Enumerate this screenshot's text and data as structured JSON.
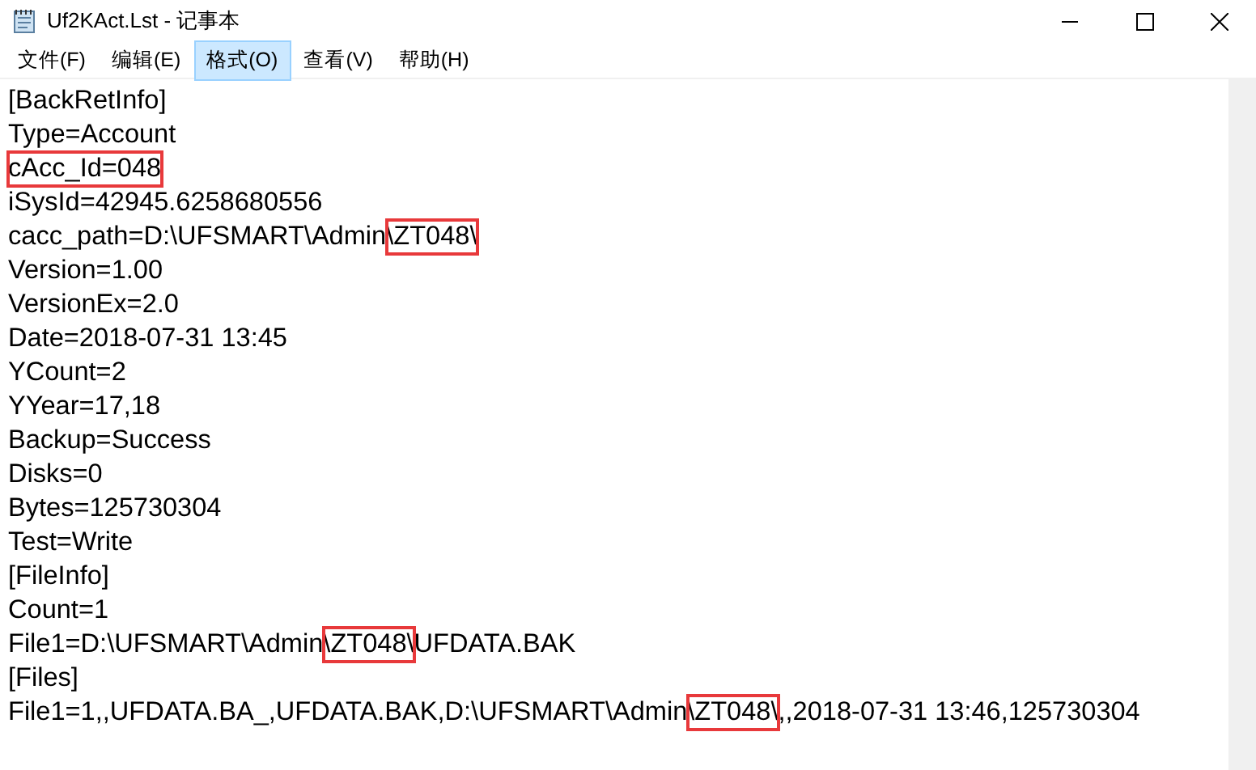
{
  "window": {
    "title": "Uf2KAct.Lst - 记事本"
  },
  "menu": [
    {
      "label": "文件(F)",
      "selected": false
    },
    {
      "label": "编辑(E)",
      "selected": false
    },
    {
      "label": "格式(O)",
      "selected": true
    },
    {
      "label": "查看(V)",
      "selected": false
    },
    {
      "label": "帮助(H)",
      "selected": false
    }
  ],
  "lines": [
    [
      {
        "text": "[BackRetInfo]",
        "boxed": false
      }
    ],
    [
      {
        "text": "Type=Account",
        "boxed": false
      }
    ],
    [
      {
        "text": "cAcc_Id=048",
        "boxed": true
      }
    ],
    [
      {
        "text": "iSysId=42945.6258680556",
        "boxed": false
      }
    ],
    [
      {
        "text": "cacc_path=D:\\UFSMART\\Admin",
        "boxed": false
      },
      {
        "text": "\\ZT048\\",
        "boxed": true
      }
    ],
    [
      {
        "text": "Version=1.00",
        "boxed": false
      }
    ],
    [
      {
        "text": "VersionEx=2.0",
        "boxed": false
      }
    ],
    [
      {
        "text": "Date=2018-07-31 13:45",
        "boxed": false
      }
    ],
    [
      {
        "text": "YCount=2",
        "boxed": false
      }
    ],
    [
      {
        "text": "YYear=17,18",
        "boxed": false
      }
    ],
    [
      {
        "text": "Backup=Success",
        "boxed": false
      }
    ],
    [
      {
        "text": "Disks=0",
        "boxed": false
      }
    ],
    [
      {
        "text": "Bytes=125730304",
        "boxed": false
      }
    ],
    [
      {
        "text": "Test=Write",
        "boxed": false
      }
    ],
    [
      {
        "text": "[FileInfo]",
        "boxed": false
      }
    ],
    [
      {
        "text": "Count=1",
        "boxed": false
      }
    ],
    [
      {
        "text": "File1=D:\\UFSMART\\Admin",
        "boxed": false
      },
      {
        "text": "\\ZT048\\",
        "boxed": true
      },
      {
        "text": "UFDATA.BAK",
        "boxed": false
      }
    ],
    [
      {
        "text": "[Files]",
        "boxed": false
      }
    ],
    [
      {
        "text": "File1=1,,UFDATA.BA_,UFDATA.BAK,D:\\UFSMART\\Admin",
        "boxed": false
      },
      {
        "text": "\\ZT048\\",
        "boxed": true
      },
      {
        "text": ",,2018-07-31 13:46,125730304",
        "boxed": false
      }
    ]
  ]
}
